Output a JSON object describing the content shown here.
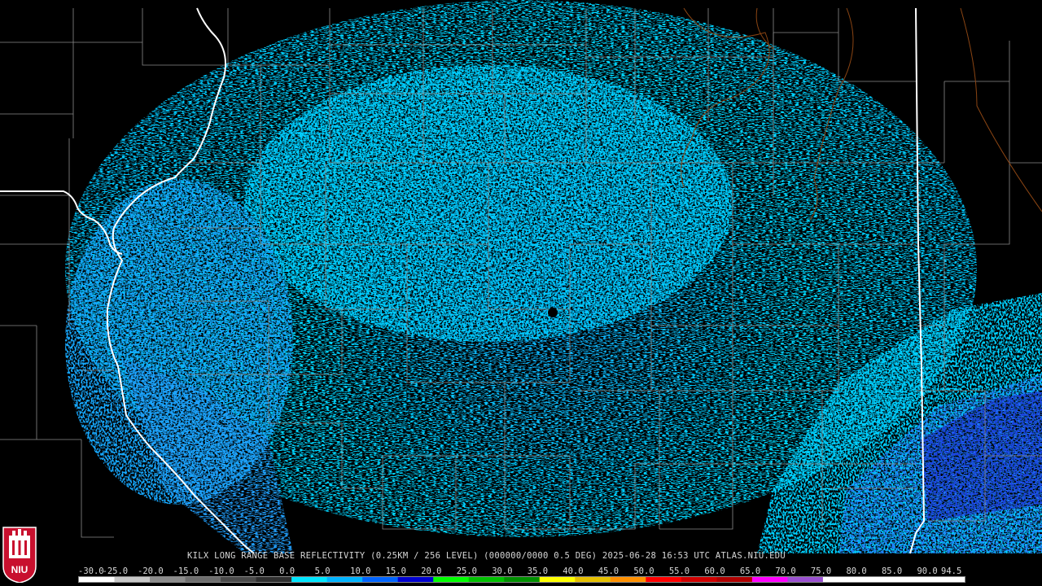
{
  "product": {
    "caption": "KILX LONG RANGE BASE REFLECTIVITY (0.25KM / 256 LEVEL) (000000/0000 0.5 DEG) 2025-06-28 16:53 UTC  ATLAS.NIU.EDU"
  },
  "scale": {
    "labels": [
      "-30.0",
      "-25.0",
      "-20.0",
      "-15.0",
      "-10.0",
      "-5.0",
      "0.0",
      "5.0",
      "10.0",
      "15.0",
      "20.0",
      "25.0",
      "30.0",
      "35.0",
      "40.0",
      "45.0",
      "50.0",
      "55.0",
      "60.0",
      "65.0",
      "70.0",
      "75.0",
      "80.0",
      "85.0",
      "90.0",
      "94.5"
    ],
    "colors": [
      "#ffffff",
      "#c8c8c8",
      "#8c8c8c",
      "#6e6e6e",
      "#4a4a4a",
      "#2f2f2f",
      "#00e6ff",
      "#00b4ff",
      "#0064ff",
      "#0000d0",
      "#00ff00",
      "#00c000",
      "#009000",
      "#ffff00",
      "#e6c000",
      "#ff9000",
      "#ff0000",
      "#d00000",
      "#b00000",
      "#ff00ff",
      "#9a50d0",
      "#ffffff",
      "#ffffff",
      "#ffffff",
      "#ffffff",
      "#ffffff"
    ]
  },
  "logo": {
    "text": "NIU",
    "color": "#c8102e"
  },
  "map_colors": {
    "counties": "#8a8a8a",
    "states": "#ffffff",
    "rivers": "#8b4513",
    "echo_light": "#00d8ff",
    "echo_mid": "#1ea0ff",
    "echo_heavy": "#1040e0"
  }
}
